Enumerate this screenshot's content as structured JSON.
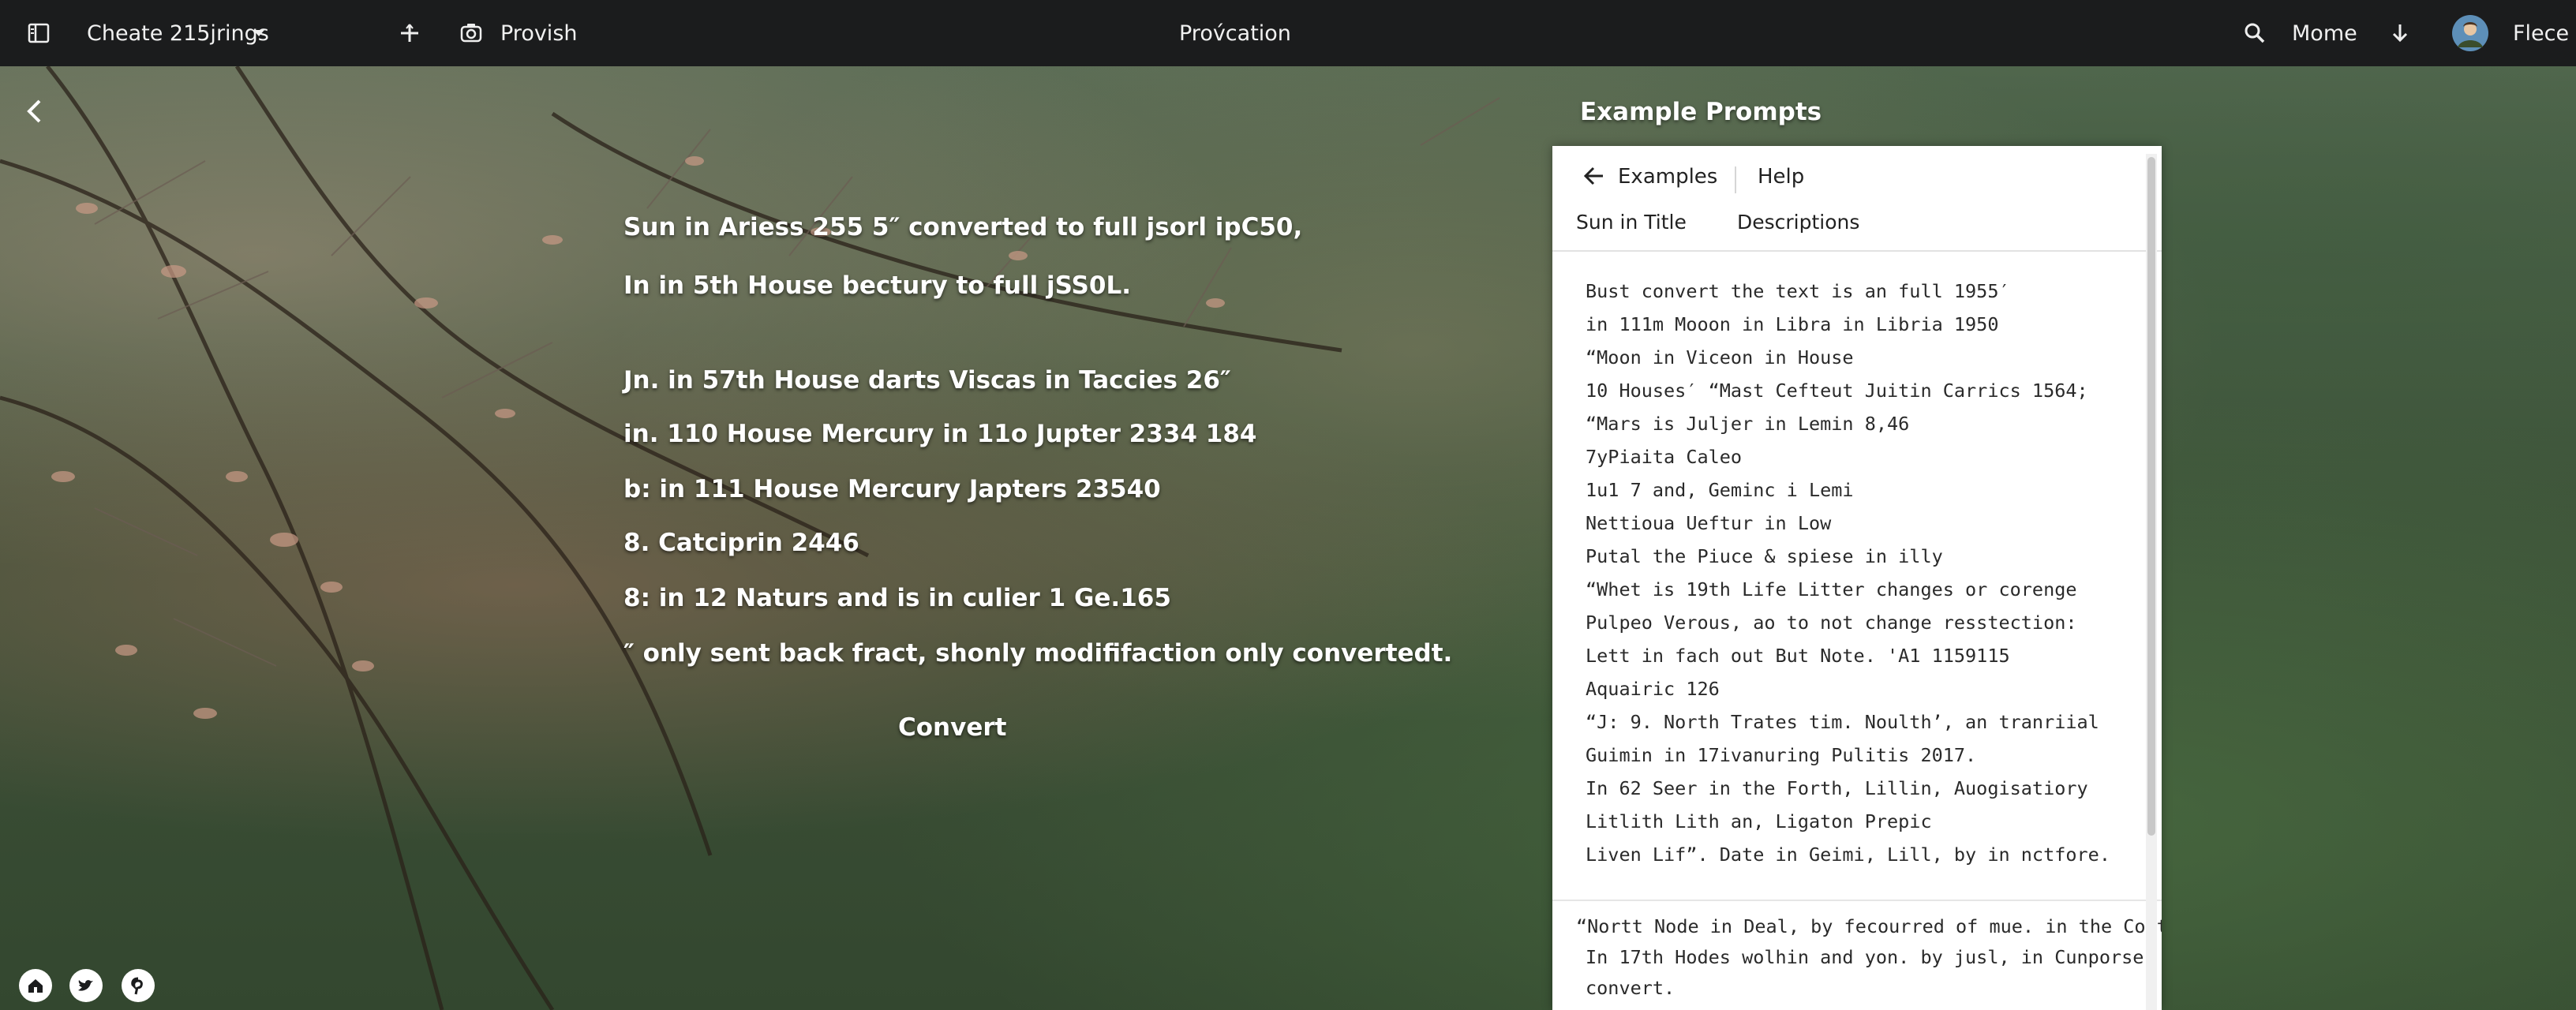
{
  "topbar": {
    "project_name": "Cheate 215jrings",
    "provish_label": "Provish",
    "center_title": "Prov́cation",
    "mome_label": "Mome",
    "user_name": "Flece"
  },
  "main": {
    "lines": [
      "Sun in Ariess 255 5″ converted to full jsorl ipC50,",
      "In in 5th House bectury to full jSS0L.",
      "Jn.  in 57th House darts Viscas in Taccies 26″",
      "in. 110 House Mercury in 11o Jupter  2334 184",
      "b: in 111 House Mercury Japters 23540",
      "8.  Catciprin 2446",
      "8: in 12 Naturs and is in culier 1 Ge.165",
      "″ only sent back fract, shonly modififaction only convertedt."
    ],
    "convert_label": "Convert"
  },
  "panel": {
    "title": "Example Prompts",
    "back_label": "Examples",
    "help_label": "Help",
    "tabs": [
      "Sun in Title",
      "Descriptions"
    ],
    "prompts": [
      "Bust convert the text is an full 1955′",
      "in 111m Mooon in Libra in Libria 1950",
      "“Moon in Viceon in House",
      "10 Houses′ “Mast Cefteut Juitin Carrics 1564;",
      "“Mars is Juljer in Lemin 8,46",
      " 7yPiaita Caleo",
      "1u1 7 and, Geminc i Lemi",
      "Nettioua Ueftur in Low",
      "Putal the Piuce & spiese in illy",
      "“Whet is 19th Life Litter changes or corenge",
      "Pulpeo Verous, ao to not change resstection:",
      "Lett in fach out But Note. 'A1 1159115",
      "Aquairic 126",
      "“J: 9. North Trates tim. Noulth’, an tranriial",
      "Guimin in 17ivanuring Pulitis 2017.",
      "In 62 Seer in the Forth, Lillin, Auogisatiory",
      "Litlith Lith an, Ligaton Prepic",
      "Liven Lif”. Date in Geimi, Lill, by in nctfore."
    ],
    "bottom": [
      "“Nortt Node in Deal, by fecourred of  mue. in the Cortvicol",
      "In 17th Hodes wolhin and yon. by jusl, in Cunporse",
      "convert."
    ]
  },
  "icons": {
    "sidebar": "sidebar-toggle-icon",
    "chevron": "chevron-down-icon",
    "add": "plus-icon",
    "camera": "camera-icon",
    "search": "search-icon",
    "download": "download-icon",
    "back": "back-arrow-icon",
    "social": [
      "home-icon",
      "twitter-icon",
      "pinterest-icon"
    ]
  }
}
